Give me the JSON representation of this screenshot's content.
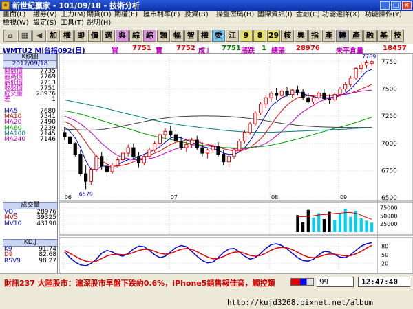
{
  "window": {
    "title": "新世紀贏家 - 101/09/18 - 技術分析"
  },
  "menu": [
    {
      "label": "畫面(L)"
    },
    {
      "label": "證券(V)"
    },
    {
      "label": "主力(M)"
    },
    {
      "label": "期貨(O)"
    },
    {
      "label": "期權(E)"
    },
    {
      "label": "匯市利率(F)"
    },
    {
      "label": "投資(B)"
    },
    {
      "label": "操盤密碼(H)"
    },
    {
      "label": "國際資訊(I)"
    },
    {
      "label": "金融(C)"
    },
    {
      "label": "功能選擇(X)"
    },
    {
      "label": "功能操作(Y)"
    },
    {
      "label": "檢視(W)"
    },
    {
      "label": "設定(S)"
    },
    {
      "label": "工具(T)"
    },
    {
      "label": "說明(H)"
    }
  ],
  "toolbar": {
    "buttons": [
      {
        "label": "加",
        "color": "#d8d0b0"
      },
      {
        "label": "權",
        "color": "#d8d0b0"
      },
      {
        "label": "即",
        "color": "#d8d0b0"
      },
      {
        "label": "價",
        "color": "#d8d0b0"
      },
      {
        "label": "選",
        "color": "#d8d0b0"
      },
      {
        "label": "與",
        "color": "#e090e0"
      },
      {
        "label": "綜",
        "color": "#d8d0b0"
      },
      {
        "label": "綜",
        "color": "#e090e0"
      },
      {
        "label": "類",
        "color": "#d8d0b0"
      },
      {
        "label": "幅",
        "color": "#d8d0b0"
      },
      {
        "label": "智",
        "color": "#d8d0b0"
      },
      {
        "label": "權",
        "color": "#d8d0b0"
      },
      {
        "label": "委",
        "color": "#70c8f0"
      },
      {
        "label": "江",
        "color": "#d8d0b0"
      },
      {
        "label": "9",
        "color": "#e8e070"
      },
      {
        "label": "8",
        "color": "#e8e070"
      },
      {
        "label": "29",
        "color": "#e8e070"
      },
      {
        "label": "核",
        "color": "#d8d0b0"
      },
      {
        "label": "興",
        "color": "#d8d0b0"
      },
      {
        "label": "指",
        "color": "#d8d0b0"
      },
      {
        "label": "產",
        "color": "#d8d0b0"
      },
      {
        "label": "轉",
        "color": "#b0b0b0"
      },
      {
        "label": "產",
        "color": "#d8d0b0"
      },
      {
        "label": "融",
        "color": "#d8d0b0"
      },
      {
        "label": "基",
        "color": "#d8d0b0"
      },
      {
        "label": "技",
        "color": "#d8d0b0"
      }
    ]
  },
  "info": {
    "symbol": "WMTU2 Mi台指092(日)",
    "buy_label": "買",
    "buy": "7751",
    "sell_label": "賣",
    "sell": "7752",
    "last_label": "成↓",
    "last": "7751",
    "chg_label": "漲跌",
    "chg": "1",
    "vol_label": "總張",
    "vol": "28976",
    "oi_label": "未平倉量",
    "oi": "18457"
  },
  "left_panel": {
    "kline_title": "K線圖",
    "date": "2012/09/18",
    "quote": [
      {
        "label": "開盤價",
        "value": "7735"
      },
      {
        "label": "最高價",
        "value": "7769"
      },
      {
        "label": "最低價",
        "value": "7713"
      },
      {
        "label": "收盤價",
        "value": "7751"
      },
      {
        "label": "成交量",
        "value": "28976"
      },
      {
        "label": "差",
        "value": "1"
      }
    ],
    "ma": [
      {
        "label": "MA5",
        "value": "7680",
        "color": "#0000e0"
      },
      {
        "label": "MA10",
        "value": "7541",
        "color": "#e00000"
      },
      {
        "label": "MA20",
        "value": "7490",
        "color": "#c000c0"
      },
      {
        "label": "MA60",
        "value": "7239",
        "color": "#00a000"
      },
      {
        "label": "MA108",
        "value": "7145",
        "color": "#008080"
      },
      {
        "label": "MA240",
        "value": "7146",
        "color": "#c000c0"
      }
    ],
    "volume_title": "成交量",
    "volume": [
      {
        "label": "VOL",
        "value": "28976",
        "color": "#0000e0"
      },
      {
        "label": "MV5",
        "value": "39325",
        "color": "#e00000"
      },
      {
        "label": "MV10",
        "value": "43190",
        "color": "#0000e0"
      }
    ],
    "kd_title": "KD,J",
    "kd": [
      {
        "label": "K9",
        "value": "91.74",
        "color": "#0000e0"
      },
      {
        "label": "D9",
        "value": "82.68",
        "color": "#e00000"
      },
      {
        "label": "RSV9",
        "value": "98.27",
        "color": "#0000e0"
      }
    ]
  },
  "chart_data": {
    "type": "candlestick",
    "x_tick_labels": [
      "06",
      "07",
      "08",
      "09"
    ],
    "price_axis": {
      "ticks": [
        "7750",
        "7500",
        "7250",
        "7000",
        "6750",
        "6500"
      ],
      "ylim": [
        6500,
        7800
      ]
    },
    "annotations": {
      "high_label": "7769",
      "low_label": "6579"
    },
    "candles": [
      {
        "o": 7100,
        "h": 7150,
        "l": 7030,
        "c": 7060
      },
      {
        "o": 7060,
        "h": 7090,
        "l": 6980,
        "c": 7000
      },
      {
        "o": 7000,
        "h": 7010,
        "l": 6880,
        "c": 6900
      },
      {
        "o": 6900,
        "h": 6940,
        "l": 6700,
        "c": 6720
      },
      {
        "o": 6720,
        "h": 6800,
        "l": 6579,
        "c": 6650
      },
      {
        "o": 6650,
        "h": 6780,
        "l": 6620,
        "c": 6760
      },
      {
        "o": 6760,
        "h": 6900,
        "l": 6740,
        "c": 6880
      },
      {
        "o": 6880,
        "h": 6920,
        "l": 6760,
        "c": 6790
      },
      {
        "o": 6790,
        "h": 6860,
        "l": 6700,
        "c": 6740
      },
      {
        "o": 6740,
        "h": 6820,
        "l": 6720,
        "c": 6800
      },
      {
        "o": 6800,
        "h": 6870,
        "l": 6780,
        "c": 6850
      },
      {
        "o": 6850,
        "h": 6930,
        "l": 6820,
        "c": 6910
      },
      {
        "o": 6910,
        "h": 6990,
        "l": 6880,
        "c": 6960
      },
      {
        "o": 6960,
        "h": 7000,
        "l": 6850,
        "c": 6880
      },
      {
        "o": 6880,
        "h": 6920,
        "l": 6780,
        "c": 6820
      },
      {
        "o": 6820,
        "h": 6900,
        "l": 6800,
        "c": 6880
      },
      {
        "o": 6880,
        "h": 6960,
        "l": 6860,
        "c": 6940
      },
      {
        "o": 6940,
        "h": 7020,
        "l": 6920,
        "c": 7000
      },
      {
        "o": 7000,
        "h": 7100,
        "l": 6980,
        "c": 7080
      },
      {
        "o": 7080,
        "h": 7140,
        "l": 7040,
        "c": 7110
      },
      {
        "o": 7110,
        "h": 7160,
        "l": 7060,
        "c": 7080
      },
      {
        "o": 7080,
        "h": 7120,
        "l": 7000,
        "c": 7020
      },
      {
        "o": 7020,
        "h": 7060,
        "l": 6940,
        "c": 6960
      },
      {
        "o": 6960,
        "h": 7020,
        "l": 6920,
        "c": 6990
      },
      {
        "o": 6990,
        "h": 7050,
        "l": 6960,
        "c": 7030
      },
      {
        "o": 7030,
        "h": 7070,
        "l": 6940,
        "c": 6960
      },
      {
        "o": 6960,
        "h": 7010,
        "l": 6880,
        "c": 6910
      },
      {
        "o": 6910,
        "h": 6960,
        "l": 6860,
        "c": 6940
      },
      {
        "o": 6940,
        "h": 7000,
        "l": 6910,
        "c": 6970
      },
      {
        "o": 6970,
        "h": 7010,
        "l": 6880,
        "c": 6900
      },
      {
        "o": 6900,
        "h": 6940,
        "l": 6800,
        "c": 6830
      },
      {
        "o": 6830,
        "h": 6900,
        "l": 6780,
        "c": 6880
      },
      {
        "o": 6880,
        "h": 6960,
        "l": 6860,
        "c": 6940
      },
      {
        "o": 6940,
        "h": 7040,
        "l": 6920,
        "c": 7020
      },
      {
        "o": 7020,
        "h": 7120,
        "l": 7000,
        "c": 7100
      },
      {
        "o": 7100,
        "h": 7200,
        "l": 7080,
        "c": 7180
      },
      {
        "o": 7180,
        "h": 7300,
        "l": 7160,
        "c": 7280
      },
      {
        "o": 7280,
        "h": 7380,
        "l": 7260,
        "c": 7360
      },
      {
        "o": 7360,
        "h": 7440,
        "l": 7320,
        "c": 7420
      },
      {
        "o": 7420,
        "h": 7480,
        "l": 7380,
        "c": 7460
      },
      {
        "o": 7460,
        "h": 7510,
        "l": 7400,
        "c": 7440
      },
      {
        "o": 7440,
        "h": 7500,
        "l": 7410,
        "c": 7480
      },
      {
        "o": 7480,
        "h": 7520,
        "l": 7430,
        "c": 7450
      },
      {
        "o": 7450,
        "h": 7500,
        "l": 7420,
        "c": 7490
      },
      {
        "o": 7490,
        "h": 7530,
        "l": 7440,
        "c": 7470
      },
      {
        "o": 7470,
        "h": 7500,
        "l": 7400,
        "c": 7420
      },
      {
        "o": 7420,
        "h": 7460,
        "l": 7360,
        "c": 7380
      },
      {
        "o": 7380,
        "h": 7440,
        "l": 7360,
        "c": 7420
      },
      {
        "o": 7420,
        "h": 7480,
        "l": 7400,
        "c": 7460
      },
      {
        "o": 7460,
        "h": 7500,
        "l": 7400,
        "c": 7410
      },
      {
        "o": 7410,
        "h": 7450,
        "l": 7360,
        "c": 7400
      },
      {
        "o": 7400,
        "h": 7470,
        "l": 7380,
        "c": 7450
      },
      {
        "o": 7450,
        "h": 7520,
        "l": 7430,
        "c": 7500
      },
      {
        "o": 7500,
        "h": 7560,
        "l": 7470,
        "c": 7540
      },
      {
        "o": 7540,
        "h": 7620,
        "l": 7520,
        "c": 7600
      },
      {
        "o": 7600,
        "h": 7700,
        "l": 7580,
        "c": 7690
      },
      {
        "o": 7690,
        "h": 7740,
        "l": 7650,
        "c": 7720
      },
      {
        "o": 7720,
        "h": 7760,
        "l": 7690,
        "c": 7740
      },
      {
        "o": 7735,
        "h": 7769,
        "l": 7713,
        "c": 7751
      }
    ],
    "ma_lines": [
      {
        "name": "MA5",
        "color": "#0000e0",
        "values": [
          7150,
          7110,
          7050,
          6960,
          6840,
          6760,
          6760,
          6790,
          6790,
          6780,
          6800,
          6830,
          6850,
          6860,
          6880,
          6900,
          6920,
          6940,
          6970,
          7010,
          7050,
          7060,
          7050,
          7030,
          7010,
          6990,
          6970,
          6960,
          6950,
          6940,
          6910,
          6900,
          6900,
          6920,
          6960,
          7020,
          7100,
          7180,
          7260,
          7340,
          7380,
          7420,
          7440,
          7460,
          7470,
          7460,
          7440,
          7430,
          7420,
          7420,
          7420,
          7420,
          7440,
          7460,
          7500,
          7550,
          7610,
          7660,
          7680
        ]
      },
      {
        "name": "MA10",
        "color": "#e00000",
        "values": [
          7200,
          7180,
          7140,
          7080,
          7010,
          6940,
          6880,
          6840,
          6810,
          6790,
          6790,
          6800,
          6810,
          6830,
          6850,
          6870,
          6890,
          6910,
          6930,
          6960,
          6990,
          7010,
          7020,
          7030,
          7030,
          7020,
          7000,
          6990,
          6980,
          6970,
          6950,
          6940,
          6930,
          6930,
          6940,
          6960,
          7000,
          7040,
          7100,
          7170,
          7240,
          7300,
          7350,
          7390,
          7420,
          7430,
          7440,
          7440,
          7440,
          7440,
          7440,
          7440,
          7440,
          7450,
          7460,
          7480,
          7500,
          7520,
          7541
        ]
      },
      {
        "name": "MA20",
        "color": "#c000c0",
        "values": [
          7250,
          7230,
          7210,
          7180,
          7140,
          7100,
          7050,
          7000,
          6960,
          6920,
          6890,
          6870,
          6860,
          6850,
          6850,
          6850,
          6860,
          6870,
          6890,
          6910,
          6930,
          6950,
          6960,
          6970,
          6980,
          6980,
          6980,
          6980,
          6980,
          6970,
          6960,
          6960,
          6950,
          6950,
          6950,
          6960,
          6970,
          6980,
          7000,
          7030,
          7070,
          7110,
          7160,
          7200,
          7250,
          7290,
          7320,
          7350,
          7380,
          7400,
          7420,
          7430,
          7440,
          7450,
          7460,
          7470,
          7480,
          7485,
          7490
        ]
      },
      {
        "name": "MA60",
        "color": "#00a000",
        "values": [
          7300,
          7290,
          7280,
          7270,
          7255,
          7240,
          7225,
          7210,
          7195,
          7180,
          7165,
          7150,
          7135,
          7120,
          7105,
          7090,
          7078,
          7066,
          7055,
          7045,
          7035,
          7025,
          7015,
          7005,
          6995,
          6988,
          6982,
          6976,
          6970,
          6966,
          6962,
          6960,
          6958,
          6958,
          6960,
          6963,
          6966,
          6970,
          6976,
          6984,
          6994,
          7004,
          7016,
          7028,
          7040,
          7054,
          7068,
          7082,
          7096,
          7110,
          7124,
          7138,
          7150,
          7162,
          7176,
          7192,
          7208,
          7224,
          7239
        ]
      },
      {
        "name": "MA108",
        "color": "#008080",
        "values": [
          7400,
          7390,
          7380,
          7370,
          7360,
          7350,
          7340,
          7330,
          7318,
          7306,
          7294,
          7282,
          7270,
          7258,
          7246,
          7234,
          7222,
          7212,
          7202,
          7192,
          7184,
          7176,
          7168,
          7162,
          7156,
          7150,
          7144,
          7138,
          7132,
          7126,
          7120,
          7116,
          7112,
          7108,
          7106,
          7104,
          7102,
          7102,
          7102,
          7102,
          7104,
          7106,
          7108,
          7110,
          7112,
          7114,
          7116,
          7118,
          7120,
          7122,
          7124,
          7126,
          7128,
          7130,
          7134,
          7137,
          7140,
          7143,
          7145
        ]
      },
      {
        "name": "MA240",
        "color": "#404040",
        "values": [
          7130,
          7128,
          7126,
          7124,
          7122,
          7122,
          7124,
          7128,
          7134,
          7142,
          7150,
          7160,
          7170,
          7180,
          7190,
          7200,
          7210,
          7218,
          7226,
          7232,
          7238,
          7242,
          7246,
          7248,
          7250,
          7251,
          7252,
          7252,
          7251,
          7250,
          7248,
          7246,
          7242,
          7238,
          7234,
          7228,
          7222,
          7216,
          7208,
          7200,
          7192,
          7184,
          7178,
          7172,
          7166,
          7162,
          7158,
          7155,
          7152,
          7150,
          7149,
          7148,
          7147,
          7146,
          7146,
          7146,
          7146,
          7146,
          7146
        ]
      }
    ],
    "volume_axis": {
      "ticks": [
        "75000",
        "50000",
        "25000"
      ],
      "ylim": [
        0,
        80000
      ]
    },
    "volume": [
      0,
      0,
      0,
      0,
      0,
      0,
      0,
      0,
      0,
      0,
      0,
      0,
      0,
      0,
      0,
      0,
      0,
      0,
      0,
      0,
      0,
      0,
      0,
      0,
      0,
      0,
      0,
      0,
      0,
      0,
      0,
      0,
      0,
      0,
      0,
      0,
      0,
      0,
      0,
      0,
      0,
      0,
      0,
      0,
      52000,
      30000,
      68000,
      45000,
      58000,
      40000,
      62000,
      38000,
      55000,
      72000,
      47000,
      65000,
      42000,
      35000,
      28976
    ],
    "volume_ma": [
      {
        "name": "MV5",
        "color": "#e00000",
        "values": [
          48000,
          47000,
          49000,
          50000,
          53000,
          54000,
          55000,
          57000,
          58000,
          60000,
          60000,
          58000,
          52000,
          45000,
          39325
        ]
      }
    ],
    "kd_axis": {
      "ticks": [
        "80",
        "50",
        "20"
      ],
      "ylim": [
        0,
        100
      ]
    },
    "kd_lines": [
      {
        "name": "K9",
        "color": "#0000e0",
        "values": [
          60,
          40,
          25,
          15,
          12,
          20,
          35,
          55,
          65,
          60,
          50,
          45,
          55,
          70,
          80,
          78,
          65,
          50,
          40,
          45,
          60,
          75,
          82,
          78,
          62,
          45,
          30,
          22,
          25,
          40,
          58,
          70,
          72,
          60,
          45,
          35,
          40,
          55,
          72,
          85,
          88,
          82,
          70,
          55,
          40,
          30,
          28,
          35,
          50,
          62,
          60,
          50,
          42,
          40,
          50,
          65,
          80,
          88,
          91.74
        ]
      },
      {
        "name": "D9",
        "color": "#e00000",
        "values": [
          65,
          55,
          45,
          35,
          28,
          25,
          28,
          37,
          46,
          51,
          52,
          50,
          52,
          58,
          65,
          69,
          68,
          62,
          55,
          52,
          55,
          62,
          69,
          72,
          69,
          61,
          51,
          42,
          36,
          37,
          44,
          53,
          59,
          60,
          55,
          48,
          45,
          48,
          56,
          66,
          73,
          76,
          74,
          68,
          59,
          49,
          42,
          40,
          43,
          49,
          53,
          52,
          49,
          46,
          47,
          53,
          62,
          73,
          82.68
        ]
      }
    ]
  },
  "status": {
    "ticker": "財訊237 大陸股市：滬深股市早盤下跌約0.6%，iPhone5銷售報佳音，觸控類",
    "code": "99",
    "clock": "12:47:40"
  },
  "url": "http://kujd3268.pixnet.net/album"
}
